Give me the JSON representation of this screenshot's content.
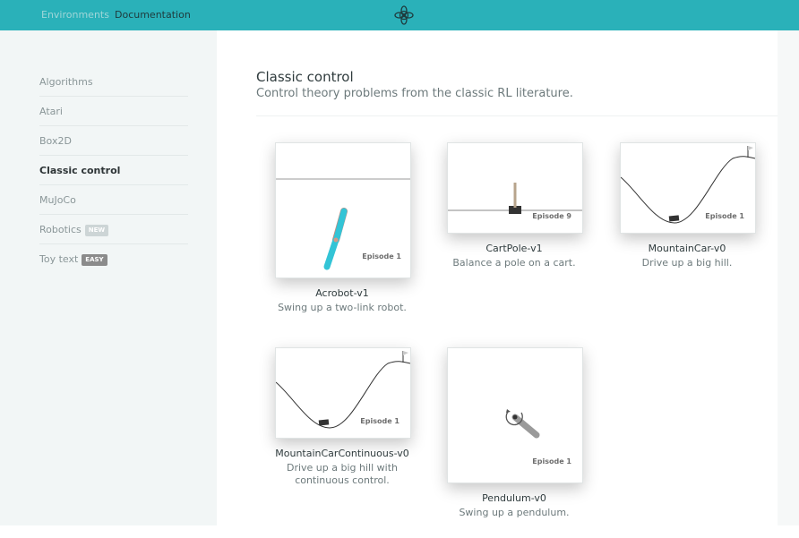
{
  "topbar": {
    "environments_label": "Environments",
    "documentation_label": "Documentation",
    "logo_icon": "openai-gym-logo-icon",
    "color": "#2ab1b9"
  },
  "sidebar": {
    "items": [
      {
        "label": "Algorithms"
      },
      {
        "label": "Atari"
      },
      {
        "label": "Box2D"
      },
      {
        "label": "Classic control",
        "active": true
      },
      {
        "label": "MuJoCo"
      },
      {
        "label": "Robotics",
        "badge": "NEW"
      },
      {
        "label": "Toy text",
        "badge": "EASY"
      }
    ]
  },
  "main": {
    "title": "Classic control",
    "subtitle": "Control theory problems from the classic RL literature.",
    "envs": [
      {
        "name": "Acrobot-v1",
        "desc": "Swing up a two-link robot.",
        "episode": "Episode 1"
      },
      {
        "name": "CartPole-v1",
        "desc": "Balance a pole on a cart.",
        "episode": "Episode 9"
      },
      {
        "name": "MountainCar-v0",
        "desc": "Drive up a big hill.",
        "episode": "Episode 1"
      },
      {
        "name": "MountainCarContinuous-v0",
        "desc_line1": "Drive up a big hill with",
        "desc_line2": "continuous control.",
        "episode": "Episode 1"
      },
      {
        "name": "Pendulum-v0",
        "desc": "Swing up a pendulum.",
        "episode": "Episode 1"
      }
    ]
  }
}
